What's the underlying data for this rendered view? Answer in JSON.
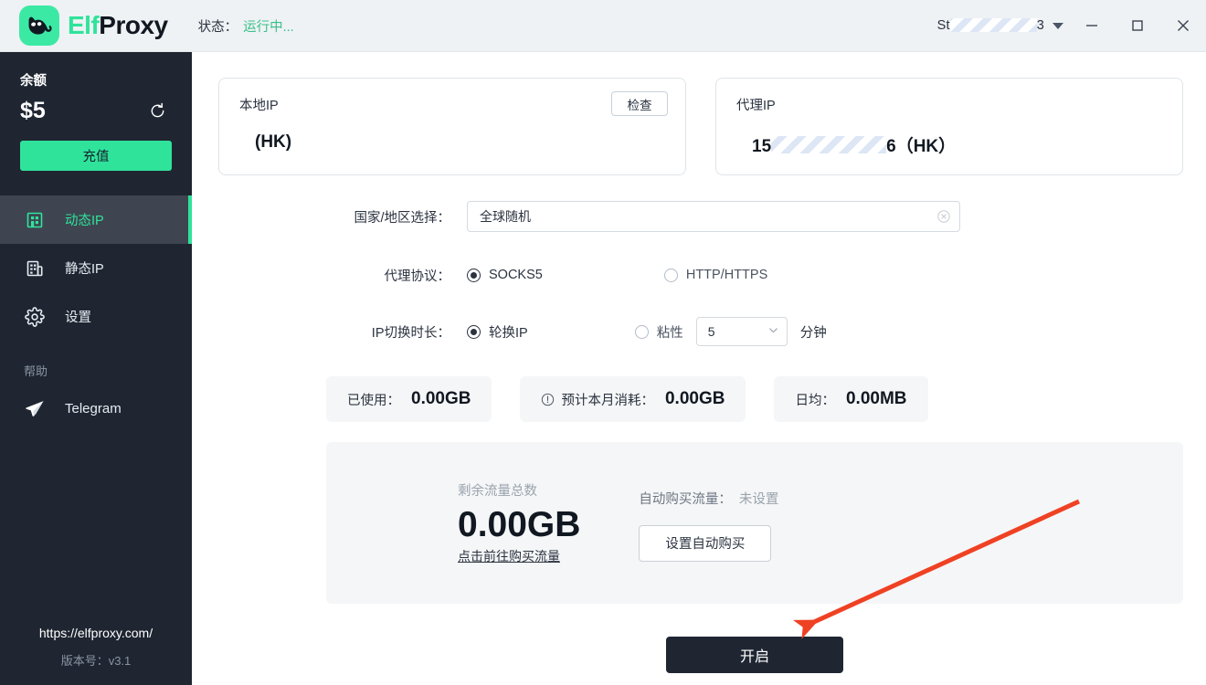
{
  "titlebar": {
    "logo_icon": "cat-logo-icon",
    "brand_prefix": "Elf",
    "brand_suffix": "Proxy",
    "status_label": "状态：",
    "status_value": "运行中...",
    "account_prefix": "St",
    "account_suffix": "3",
    "account_caret_icon": "chevron-down-icon",
    "minimize_icon": "minimize-icon",
    "maximize_icon": "maximize-icon",
    "close_icon": "close-icon"
  },
  "sidebar": {
    "balance_label": "余额",
    "balance_amount": "$5",
    "refresh_icon": "refresh-icon",
    "recharge_label": "充值",
    "items": [
      {
        "label": "动态IP",
        "icon": "dynamic-ip-icon",
        "active": true
      },
      {
        "label": "静态IP",
        "icon": "static-ip-icon",
        "active": false
      },
      {
        "label": "设置",
        "icon": "gear-icon",
        "active": false
      }
    ],
    "help_label": "帮助",
    "telegram_label": "Telegram",
    "telegram_icon": "telegram-icon",
    "url": "https://elfproxy.com/",
    "version": "版本号：v3.1"
  },
  "main": {
    "local_ip": {
      "title": "本地IP",
      "value": "(HK)",
      "check_label": "检查"
    },
    "proxy_ip": {
      "title": "代理IP",
      "value_prefix": "15",
      "value_suffix": "6（HK）"
    },
    "region": {
      "label": "国家/地区选择：",
      "value": "全球随机",
      "clear_icon": "clear-circle-icon"
    },
    "protocol": {
      "label": "代理协议：",
      "options": [
        {
          "label": "SOCKS5",
          "selected": true
        },
        {
          "label": "HTTP/HTTPS",
          "selected": false
        }
      ]
    },
    "rotation": {
      "label": "IP切换时长：",
      "options": [
        {
          "label": "轮换IP",
          "selected": true
        },
        {
          "label": "粘性",
          "selected": false
        }
      ],
      "minutes_value": "5",
      "minutes_caret_icon": "chevron-down-icon",
      "unit": "分钟"
    },
    "stats": [
      {
        "label": "已使用：",
        "value": "0.00GB",
        "icon": null
      },
      {
        "label": "预计本月消耗：",
        "value": "0.00GB",
        "icon": "info-icon"
      },
      {
        "label": "日均：",
        "value": "0.00MB",
        "icon": null
      }
    ],
    "traffic": {
      "title": "剩余流量总数",
      "value": "0.00GB",
      "buy_link": "点击前往购买流量",
      "auto_label": "自动购买流量：",
      "auto_value": "未设置",
      "auto_button": "设置自动购买"
    },
    "start_button": "开启",
    "annotation_arrow": {
      "icon": "red-arrow-annotation",
      "color": "#ef4123"
    }
  }
}
